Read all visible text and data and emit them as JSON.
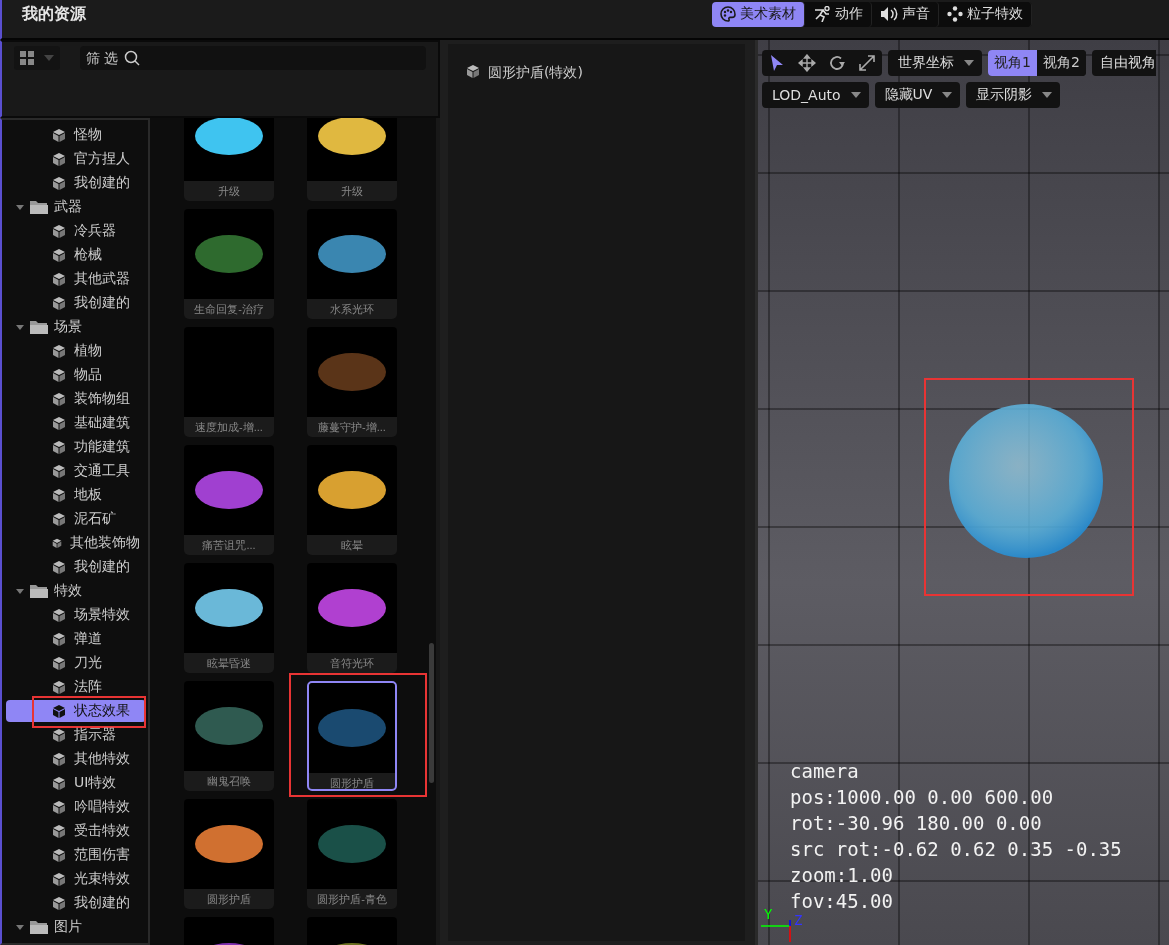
{
  "header": {
    "title": "我的资源"
  },
  "tabs": [
    {
      "label": "美术素材",
      "selected": true
    },
    {
      "label": "动作",
      "selected": false
    },
    {
      "label": "声音",
      "selected": false
    },
    {
      "label": "粒子特效",
      "selected": false
    }
  ],
  "toolbar": {
    "grid_view": true,
    "filter": {
      "placeholder": "筛 选"
    }
  },
  "tree": [
    {
      "kind": "leaf",
      "label": "怪物",
      "selected": false
    },
    {
      "kind": "leaf",
      "label": "官方捏人",
      "selected": false
    },
    {
      "kind": "leaf",
      "label": "我创建的",
      "selected": false
    },
    {
      "kind": "folder",
      "label": "武器",
      "expanded": true,
      "children": [
        {
          "label": "冷兵器",
          "selected": false
        },
        {
          "label": "枪械",
          "selected": false
        },
        {
          "label": "其他武器",
          "selected": false
        },
        {
          "label": "我创建的",
          "selected": false
        }
      ]
    },
    {
      "kind": "folder",
      "label": "场景",
      "expanded": true,
      "children": [
        {
          "label": "植物",
          "selected": false
        },
        {
          "label": "物品",
          "selected": false
        },
        {
          "label": "装饰物组",
          "selected": false
        },
        {
          "label": "基础建筑",
          "selected": false
        },
        {
          "label": "功能建筑",
          "selected": false
        },
        {
          "label": "交通工具",
          "selected": false
        },
        {
          "label": "地板",
          "selected": false
        },
        {
          "label": "泥石矿",
          "selected": false
        },
        {
          "label": "其他装饰物",
          "selected": false
        },
        {
          "label": "我创建的",
          "selected": false
        }
      ]
    },
    {
      "kind": "folder",
      "label": "特效",
      "expanded": true,
      "children": [
        {
          "label": "场景特效",
          "selected": false
        },
        {
          "label": "弹道",
          "selected": false
        },
        {
          "label": "刀光",
          "selected": false
        },
        {
          "label": "法阵",
          "selected": false
        },
        {
          "label": "状态效果",
          "selected": true,
          "annotated": true
        },
        {
          "label": "指示器",
          "selected": false
        },
        {
          "label": "其他特效",
          "selected": false
        },
        {
          "label": "UI特效",
          "selected": false
        },
        {
          "label": "吟唱特效",
          "selected": false
        },
        {
          "label": "受击特效",
          "selected": false
        },
        {
          "label": "范围伤害",
          "selected": false
        },
        {
          "label": "光束特效",
          "selected": false
        },
        {
          "label": "我创建的",
          "selected": false
        }
      ]
    },
    {
      "kind": "folder",
      "label": "图片",
      "expanded": true
    }
  ],
  "assets": [
    {
      "label": "升级",
      "color": "#3fc4f0",
      "selected": false
    },
    {
      "label": "升级",
      "color": "#e0b840",
      "selected": false
    },
    {
      "label": "生命回复-治疗",
      "color": "#2e6a2e",
      "selected": false
    },
    {
      "label": "水系光环",
      "color": "#3a86b0",
      "selected": false
    },
    {
      "label": "速度加成-增...",
      "selected": false
    },
    {
      "label": "藤蔓守护-增...",
      "color": "#5a3418",
      "selected": false
    },
    {
      "label": "痛苦诅咒...",
      "color": "#a040d0",
      "selected": false
    },
    {
      "label": "眩晕",
      "color": "#d8a030",
      "selected": false
    },
    {
      "label": "眩晕昏迷",
      "color": "#6ab8d8",
      "selected": false
    },
    {
      "label": "音符光环",
      "color": "#b040d0",
      "selected": false
    },
    {
      "label": "幽鬼召唤",
      "color": "#2f5a50",
      "selected": false
    },
    {
      "label": "圆形护盾",
      "color": "#1a4a70",
      "selected": true,
      "annotated": true
    },
    {
      "label": "圆形护盾",
      "color": "#d07030",
      "selected": false
    },
    {
      "label": "圆形护盾-青色",
      "color": "#1a5048",
      "selected": false
    },
    {
      "color": "#8030b0",
      "selected": false
    },
    {
      "color": "#6a7020",
      "selected": false
    }
  ],
  "details": {
    "item": "圆形护盾(特效)"
  },
  "viewport": {
    "tools": [
      {
        "selected": true
      },
      {
        "selected": false
      },
      {
        "selected": false
      },
      {
        "selected": false
      }
    ],
    "space": "世界坐标",
    "views": [
      {
        "label": "视角1",
        "selected": true
      },
      {
        "label": "视角2",
        "selected": false
      }
    ],
    "free_view": "自由视角",
    "dropdowns": [
      "LOD_Auto",
      "隐藏UV",
      "显示阴影"
    ],
    "sphere_annotated": true,
    "camera": [
      "camera",
      "pos:1000.00 0.00 600.00",
      "rot:-30.96 180.00 0.00",
      "src rot:-0.62 0.62 0.35 -0.35",
      "zoom:1.00",
      "fov:45.00"
    ],
    "axes": [
      "Y",
      "Z"
    ]
  }
}
